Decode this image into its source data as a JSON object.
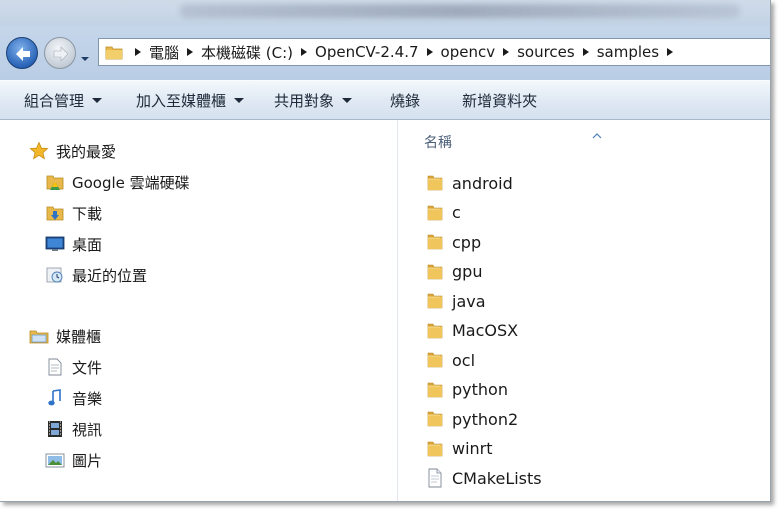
{
  "breadcrumb": [
    "電腦",
    "本機磁碟 (C:)",
    "OpenCV-2.4.7",
    "opencv",
    "sources",
    "samples"
  ],
  "toolbar": {
    "organize": "組合管理",
    "add_to_library": "加入至媒體櫃",
    "share_with": "共用對象",
    "burn": "燒錄",
    "new_folder": "新增資料夾"
  },
  "nav": {
    "favorites": {
      "title": "我的最愛",
      "items": [
        {
          "label": "Google 雲端硬碟",
          "icon": "google-drive-folder-icon"
        },
        {
          "label": "下載",
          "icon": "downloads-icon"
        },
        {
          "label": "桌面",
          "icon": "desktop-icon"
        },
        {
          "label": "最近的位置",
          "icon": "recent-places-icon"
        }
      ]
    },
    "libraries": {
      "title": "媒體櫃",
      "items": [
        {
          "label": "文件",
          "icon": "documents-icon"
        },
        {
          "label": "音樂",
          "icon": "music-icon"
        },
        {
          "label": "視訊",
          "icon": "videos-icon"
        },
        {
          "label": "圖片",
          "icon": "pictures-icon"
        }
      ]
    }
  },
  "content": {
    "column_header": "名稱",
    "items": [
      {
        "name": "android",
        "type": "folder"
      },
      {
        "name": "c",
        "type": "folder"
      },
      {
        "name": "cpp",
        "type": "folder"
      },
      {
        "name": "gpu",
        "type": "folder"
      },
      {
        "name": "java",
        "type": "folder"
      },
      {
        "name": "MacOSX",
        "type": "folder"
      },
      {
        "name": "ocl",
        "type": "folder"
      },
      {
        "name": "python",
        "type": "folder"
      },
      {
        "name": "python2",
        "type": "folder"
      },
      {
        "name": "winrt",
        "type": "folder"
      },
      {
        "name": "CMakeLists",
        "type": "file"
      }
    ]
  },
  "colors": {
    "accent": "#2a64b8",
    "folder": "#e8b94a",
    "header_text": "#4c607a"
  }
}
